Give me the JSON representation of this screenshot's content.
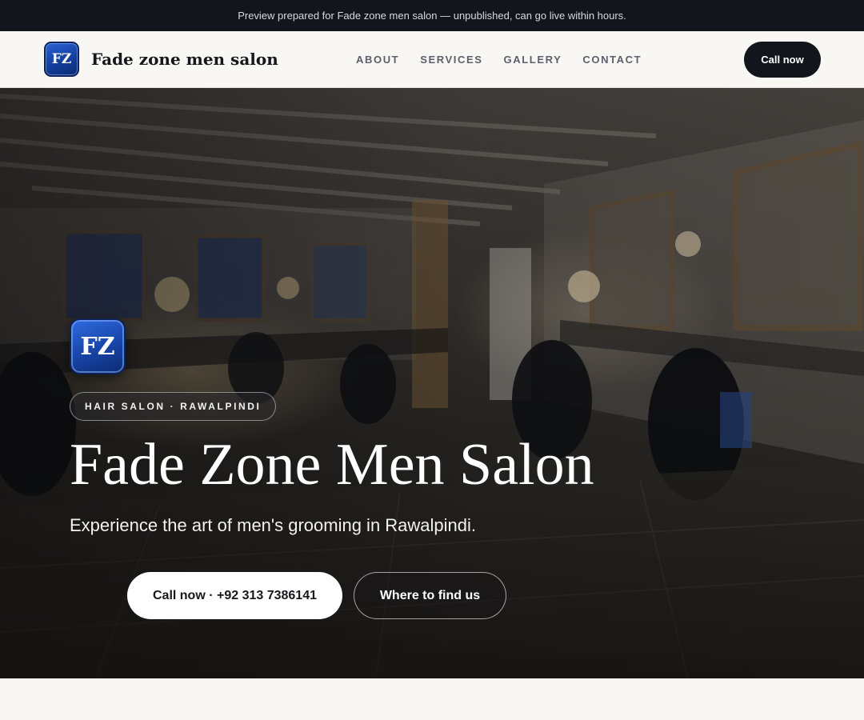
{
  "announcement": {
    "text": "Preview prepared for Fade zone men salon — unpublished, can go live within hours."
  },
  "header": {
    "logo_text": "FZ",
    "brand_name": "Fade zone men salon",
    "menu": [
      {
        "label": "ABOUT"
      },
      {
        "label": "SERVICES"
      },
      {
        "label": "GALLERY"
      },
      {
        "label": "CONTACT"
      }
    ],
    "cta_label": "Call now"
  },
  "hero": {
    "logo_text": "FZ",
    "badge": "HAIR SALON · RAWALPINDI",
    "title": "Fade Zone Men Salon",
    "subtitle": "Experience the art of men's grooming in Rawalpindi.",
    "primary_button": "Call now · +92 313 7386141",
    "secondary_button": "Where to find us"
  },
  "colors": {
    "dark": "#12151c",
    "accent_blue": "#1744a6",
    "page_bg": "#f8f7f4"
  }
}
